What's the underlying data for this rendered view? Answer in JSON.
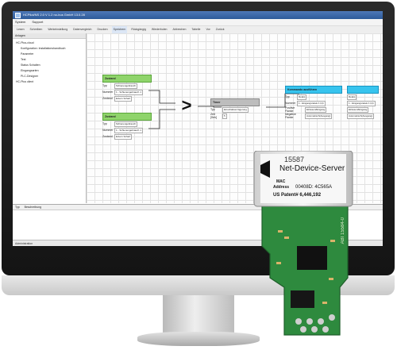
{
  "window": {
    "title": "HCPilot/NS 2.0   V 1.2   no-bus GmbH       13.0.28"
  },
  "menu": {
    "items": [
      "System",
      "Support"
    ]
  },
  "toolbar": {
    "items": [
      "Lesen",
      "Schreiben",
      "Werkeinstellung",
      "Datenvergleich",
      "Drucken",
      "Speichern",
      "Rückgängig",
      "Wiederholen",
      "Abbrechen",
      "Tabelle",
      "Vor",
      "Zurück"
    ]
  },
  "tree": {
    "header": "Anlagen",
    "nodes": [
      "HC-Plus-cloud",
      "Konfiguration: Installationshandbuch",
      "Parameter",
      "Test",
      "Status Schalten",
      "Eingangsarten",
      "PLC-Designer",
      "HC-Plus client"
    ]
  },
  "canvas": {
    "block_zustand_1": {
      "header": "Zustand",
      "rows": [
        {
          "label": "Typ",
          "value": "Schienengebrauch"
        },
        {
          "label": "Nummer",
          "value": "1 - Schienengebrauch 1"
        },
        {
          "label": "Zustand",
          "value": "Extern Scharf"
        }
      ]
    },
    "block_zustand_2": {
      "header": "Zustand",
      "rows": [
        {
          "label": "Typ",
          "value": "Schienengebrauch"
        },
        {
          "label": "Nummer",
          "value": "1 - Schienengebrauch 1"
        },
        {
          "label": "Zustand",
          "value": "Extern Scharf"
        }
      ]
    },
    "operator_symbol": ">",
    "block_timer": {
      "header": "Timer",
      "rows": [
        {
          "label": "Typ",
          "value": "Einschaltverzögerung"
        },
        {
          "label": "Zeit [Sek]",
          "value": "5"
        }
      ]
    },
    "block_kommando": {
      "header": "Kommando ausführen",
      "rows": [
        {
          "label": "Typ",
          "value": "Relais"
        },
        {
          "label": "Nummer",
          "value": "1 - Eingangsrelais 1 (H)"
        },
        {
          "label": "Positive Flanke",
          "value": "Einlesen/Eingang"
        },
        {
          "label": "Negative Flanke",
          "value": "Automatisch(Ausgang)"
        }
      ]
    },
    "block_right_small": {
      "header": "",
      "rows": [
        {
          "label": "",
          "value": "Relais"
        },
        {
          "label": "",
          "value": "1 - Eingangsrelais 1 (H)"
        },
        {
          "label": "",
          "value": "Einlesen/Eingang"
        },
        {
          "label": "",
          "value": "Automatisch(Ausgang)"
        }
      ]
    }
  },
  "bottom_panel": {
    "columns": [
      "Typ",
      "Beschreibung"
    ]
  },
  "statusbar": {
    "text": "Administration"
  },
  "device": {
    "number": "15587",
    "name": "Net-Device-Server",
    "mac_label": "MAC",
    "address_label": "Address",
    "mac_value": "00408D: 4C565A",
    "patent": "US Patent# 6,446,192",
    "board_text": "ABI 15584-0"
  },
  "colors": {
    "green_header": "#8fd46b",
    "cyan_header": "#37c4ee",
    "gray_header": "#bdbdbd",
    "pcb_green": "#2e8a3e"
  }
}
